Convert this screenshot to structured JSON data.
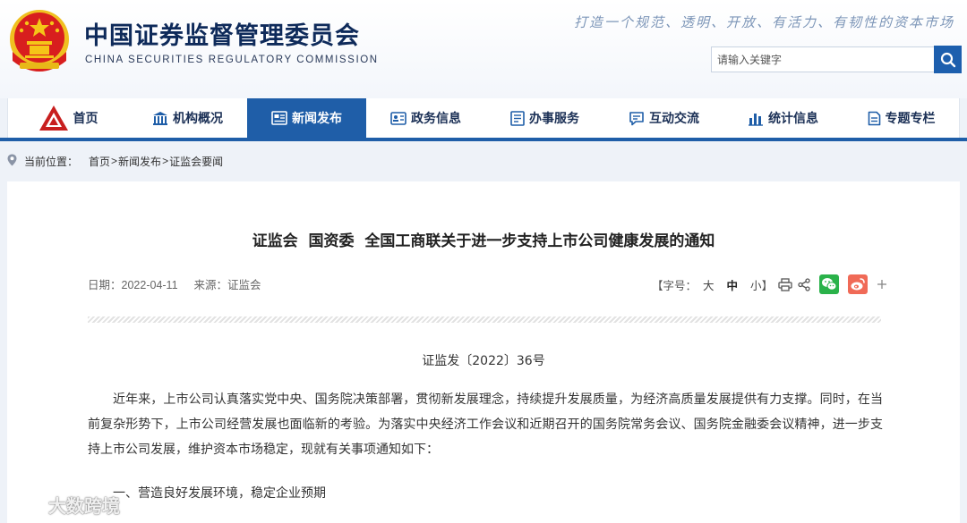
{
  "header": {
    "site_name_cn": "中国证券监督管理委员会",
    "site_name_en": "CHINA SECURITIES REGULATORY COMMISSION",
    "slogan": "打造一个规范、透明、开放、有活力、有韧性的资本市场",
    "search_placeholder": "请输入关键字"
  },
  "nav": {
    "items": [
      {
        "label": "首页",
        "icon": "home-logo-icon"
      },
      {
        "label": "机构概况",
        "icon": "building-icon"
      },
      {
        "label": "新闻发布",
        "icon": "newspaper-icon",
        "active": true
      },
      {
        "label": "政务信息",
        "icon": "id-card-icon"
      },
      {
        "label": "办事服务",
        "icon": "document-list-icon"
      },
      {
        "label": "互动交流",
        "icon": "chat-icon"
      },
      {
        "label": "统计信息",
        "icon": "bar-chart-icon"
      },
      {
        "label": "专题专栏",
        "icon": "file-icon"
      }
    ],
    "accent_color": "#1f5ea8"
  },
  "breadcrumb": {
    "label": "当前位置：",
    "items": [
      "首页",
      "新闻发布",
      "证监会要闻"
    ],
    "separator": ">"
  },
  "article": {
    "title": "证监会 国资委 全国工商联关于进一步支持上市公司健康发展的通知",
    "date_label": "日期：",
    "date": "2022-04-11",
    "source_label": "来源：",
    "source": "证监会",
    "font_size_label": "【字号：",
    "font_size_options": [
      "大",
      "中",
      "小"
    ],
    "font_size_close": "】",
    "font_size_selected": "中",
    "doc_number": "证监发〔2022〕36号",
    "paragraph_1": "近年来，上市公司认真落实党中央、国务院决策部署，贯彻新发展理念，持续提升发展质量，为经济高质量发展提供有力支撑。同时，在当前复杂形势下，上市公司经营发展也面临新的考验。为落实中央经济工作会议和近期召开的国务院常务会议、国务院金融委会议精神，进一步支持上市公司发展，维护资本市场稳定，现就有关事项通知如下：",
    "section_1": "一、营造良好发展环境，稳定企业预期"
  },
  "watermark": {
    "text": "大数跨境"
  }
}
